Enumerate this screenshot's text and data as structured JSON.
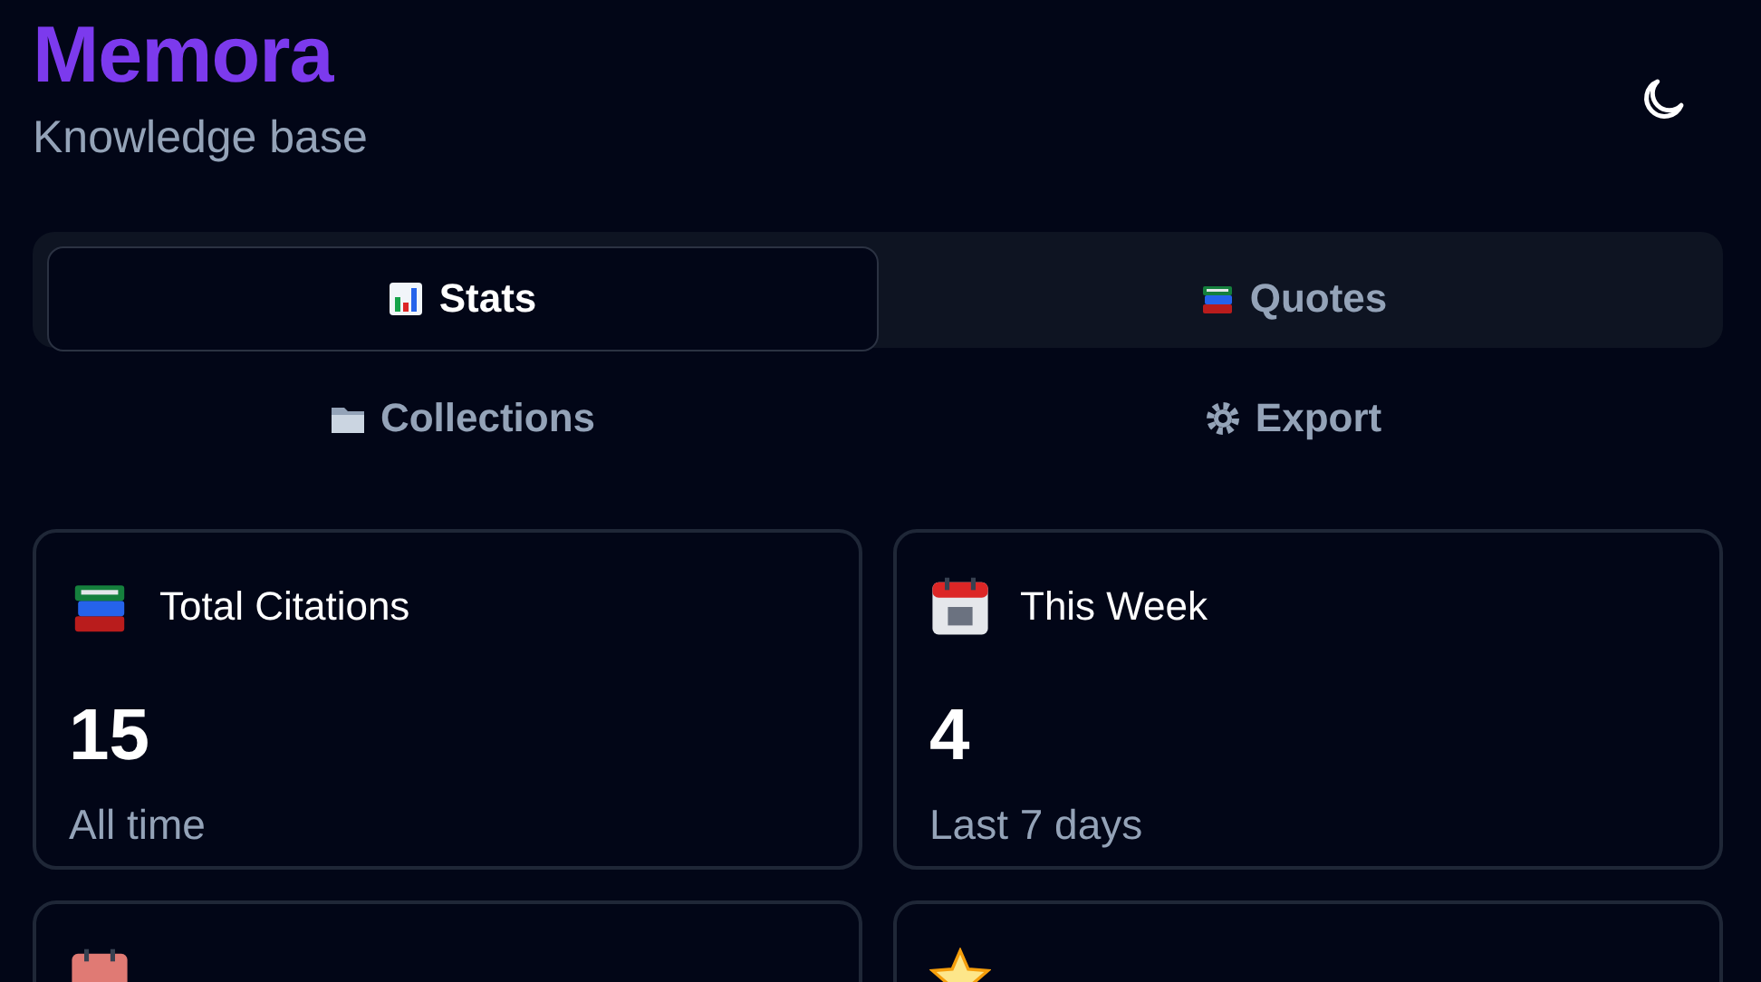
{
  "header": {
    "title": "Memora",
    "subtitle": "Knowledge base",
    "theme_toggle": {
      "kind": "moon"
    }
  },
  "tabs": [
    {
      "label": "Stats",
      "kind": "chart",
      "selected": true
    },
    {
      "label": "Quotes",
      "kind": "books",
      "selected": false
    },
    {
      "label": "Collections",
      "kind": "folder",
      "selected": false
    },
    {
      "label": "Export",
      "kind": "gear",
      "selected": false
    }
  ],
  "stat_cards": [
    {
      "kind": "books",
      "title": "Total Citations",
      "value": "15",
      "caption": "All time"
    },
    {
      "kind": "calendar",
      "title": "This Week",
      "value": "4",
      "caption": "Last 7 days"
    },
    {
      "kind": "calendar-red"
    },
    {
      "kind": "star"
    }
  ]
}
